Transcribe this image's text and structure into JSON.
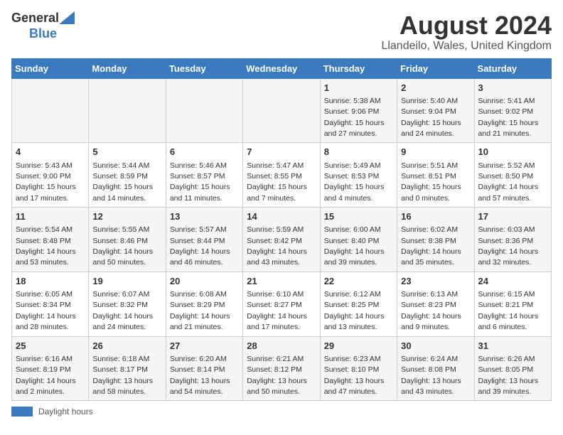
{
  "header": {
    "logo_general": "General",
    "logo_blue": "Blue",
    "title": "August 2024",
    "subtitle": "Llandeilo, Wales, United Kingdom"
  },
  "days_of_week": [
    "Sunday",
    "Monday",
    "Tuesday",
    "Wednesday",
    "Thursday",
    "Friday",
    "Saturday"
  ],
  "weeks": [
    [
      {
        "day": "",
        "info": ""
      },
      {
        "day": "",
        "info": ""
      },
      {
        "day": "",
        "info": ""
      },
      {
        "day": "",
        "info": ""
      },
      {
        "day": "1",
        "info": "Sunrise: 5:38 AM\nSunset: 9:06 PM\nDaylight: 15 hours\nand 27 minutes."
      },
      {
        "day": "2",
        "info": "Sunrise: 5:40 AM\nSunset: 9:04 PM\nDaylight: 15 hours\nand 24 minutes."
      },
      {
        "day": "3",
        "info": "Sunrise: 5:41 AM\nSunset: 9:02 PM\nDaylight: 15 hours\nand 21 minutes."
      }
    ],
    [
      {
        "day": "4",
        "info": "Sunrise: 5:43 AM\nSunset: 9:00 PM\nDaylight: 15 hours\nand 17 minutes."
      },
      {
        "day": "5",
        "info": "Sunrise: 5:44 AM\nSunset: 8:59 PM\nDaylight: 15 hours\nand 14 minutes."
      },
      {
        "day": "6",
        "info": "Sunrise: 5:46 AM\nSunset: 8:57 PM\nDaylight: 15 hours\nand 11 minutes."
      },
      {
        "day": "7",
        "info": "Sunrise: 5:47 AM\nSunset: 8:55 PM\nDaylight: 15 hours\nand 7 minutes."
      },
      {
        "day": "8",
        "info": "Sunrise: 5:49 AM\nSunset: 8:53 PM\nDaylight: 15 hours\nand 4 minutes."
      },
      {
        "day": "9",
        "info": "Sunrise: 5:51 AM\nSunset: 8:51 PM\nDaylight: 15 hours\nand 0 minutes."
      },
      {
        "day": "10",
        "info": "Sunrise: 5:52 AM\nSunset: 8:50 PM\nDaylight: 14 hours\nand 57 minutes."
      }
    ],
    [
      {
        "day": "11",
        "info": "Sunrise: 5:54 AM\nSunset: 8:48 PM\nDaylight: 14 hours\nand 53 minutes."
      },
      {
        "day": "12",
        "info": "Sunrise: 5:55 AM\nSunset: 8:46 PM\nDaylight: 14 hours\nand 50 minutes."
      },
      {
        "day": "13",
        "info": "Sunrise: 5:57 AM\nSunset: 8:44 PM\nDaylight: 14 hours\nand 46 minutes."
      },
      {
        "day": "14",
        "info": "Sunrise: 5:59 AM\nSunset: 8:42 PM\nDaylight: 14 hours\nand 43 minutes."
      },
      {
        "day": "15",
        "info": "Sunrise: 6:00 AM\nSunset: 8:40 PM\nDaylight: 14 hours\nand 39 minutes."
      },
      {
        "day": "16",
        "info": "Sunrise: 6:02 AM\nSunset: 8:38 PM\nDaylight: 14 hours\nand 35 minutes."
      },
      {
        "day": "17",
        "info": "Sunrise: 6:03 AM\nSunset: 8:36 PM\nDaylight: 14 hours\nand 32 minutes."
      }
    ],
    [
      {
        "day": "18",
        "info": "Sunrise: 6:05 AM\nSunset: 8:34 PM\nDaylight: 14 hours\nand 28 minutes."
      },
      {
        "day": "19",
        "info": "Sunrise: 6:07 AM\nSunset: 8:32 PM\nDaylight: 14 hours\nand 24 minutes."
      },
      {
        "day": "20",
        "info": "Sunrise: 6:08 AM\nSunset: 8:29 PM\nDaylight: 14 hours\nand 21 minutes."
      },
      {
        "day": "21",
        "info": "Sunrise: 6:10 AM\nSunset: 8:27 PM\nDaylight: 14 hours\nand 17 minutes."
      },
      {
        "day": "22",
        "info": "Sunrise: 6:12 AM\nSunset: 8:25 PM\nDaylight: 14 hours\nand 13 minutes."
      },
      {
        "day": "23",
        "info": "Sunrise: 6:13 AM\nSunset: 8:23 PM\nDaylight: 14 hours\nand 9 minutes."
      },
      {
        "day": "24",
        "info": "Sunrise: 6:15 AM\nSunset: 8:21 PM\nDaylight: 14 hours\nand 6 minutes."
      }
    ],
    [
      {
        "day": "25",
        "info": "Sunrise: 6:16 AM\nSunset: 8:19 PM\nDaylight: 14 hours\nand 2 minutes."
      },
      {
        "day": "26",
        "info": "Sunrise: 6:18 AM\nSunset: 8:17 PM\nDaylight: 13 hours\nand 58 minutes."
      },
      {
        "day": "27",
        "info": "Sunrise: 6:20 AM\nSunset: 8:14 PM\nDaylight: 13 hours\nand 54 minutes."
      },
      {
        "day": "28",
        "info": "Sunrise: 6:21 AM\nSunset: 8:12 PM\nDaylight: 13 hours\nand 50 minutes."
      },
      {
        "day": "29",
        "info": "Sunrise: 6:23 AM\nSunset: 8:10 PM\nDaylight: 13 hours\nand 47 minutes."
      },
      {
        "day": "30",
        "info": "Sunrise: 6:24 AM\nSunset: 8:08 PM\nDaylight: 13 hours\nand 43 minutes."
      },
      {
        "day": "31",
        "info": "Sunrise: 6:26 AM\nSunset: 8:05 PM\nDaylight: 13 hours\nand 39 minutes."
      }
    ]
  ],
  "legend": {
    "box_label": "Daylight hours"
  },
  "colors": {
    "header_bg": "#3a7abf",
    "logo_blue": "#3a7abf"
  }
}
